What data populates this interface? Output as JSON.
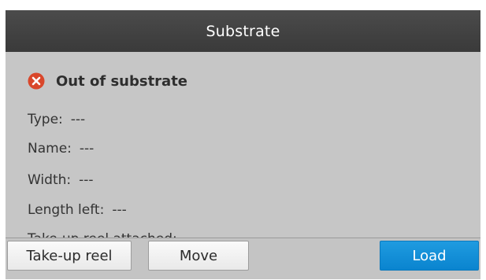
{
  "header": {
    "title": "Substrate"
  },
  "status": {
    "icon": "error-circle-icon",
    "icon_color": "#d9472b",
    "text": "Out of substrate"
  },
  "info": {
    "type_label": "Type:",
    "type_value": "---",
    "name_label": "Name:",
    "name_value": "---",
    "width_label": "Width:",
    "width_value": "---",
    "length_left_label": "Length left:",
    "length_left_value": "---",
    "partial_label": "Take-up reel attached:"
  },
  "footer": {
    "takeup_label": "Take-up reel",
    "move_label": "Move",
    "load_label": "Load"
  },
  "colors": {
    "header_bg": "#444444",
    "panel_bg": "#c6c6c6",
    "accent": "#1592db"
  }
}
